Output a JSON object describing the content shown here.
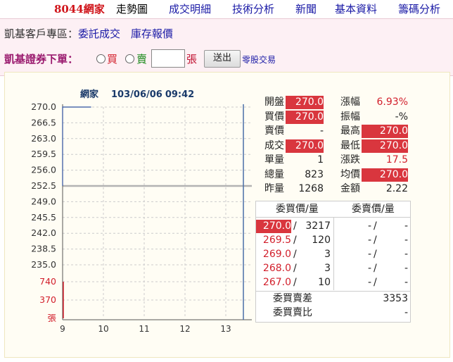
{
  "nav": {
    "stock": "8044網家",
    "items": [
      "走勢圖",
      "成交明細",
      "技術分析",
      "新聞",
      "基本資料",
      "籌碼分析"
    ]
  },
  "customer": {
    "label": "凱基客戶專區：",
    "links": [
      "委託成交",
      "庫存報價"
    ]
  },
  "order": {
    "title": "凱基證券下單：",
    "buy": "買",
    "sell": "賣",
    "unit": "張",
    "send": "送出",
    "odd_lot": "零股交易"
  },
  "chart_data": {
    "type": "line",
    "title": "網家",
    "date": "103/06/06",
    "time": "09:42",
    "price_ticks": [
      "270.0",
      "266.5",
      "263.0",
      "259.5",
      "256.0",
      "252.5",
      "249.0",
      "245.5",
      "242.0",
      "238.5",
      "235.0"
    ],
    "ylim": [
      235.0,
      270.0
    ],
    "reference_price": 252.5,
    "volume_ticks": [
      "740",
      "370",
      "張"
    ],
    "volume_max": 740,
    "x_ticks": [
      "9",
      "10",
      "11",
      "12",
      "13"
    ],
    "series": [
      {
        "x": [
          9.0,
          9.0,
          9.7
        ],
        "y": [
          252.5,
          270.0,
          270.0
        ]
      }
    ],
    "volume": {
      "x": [
        9.0
      ],
      "y": [
        740
      ]
    }
  },
  "quote": {
    "left": [
      {
        "label": "開盤",
        "value": "270.0",
        "hl": true
      },
      {
        "label": "買價",
        "value": "270.0",
        "hl": true
      },
      {
        "label": "賣價",
        "value": "-",
        "hl": false
      },
      {
        "label": "成交",
        "value": "270.0",
        "hl": true
      },
      {
        "label": "單量",
        "value": "1",
        "hl": false
      },
      {
        "label": "總量",
        "value": "823",
        "hl": false
      },
      {
        "label": "昨量",
        "value": "1268",
        "hl": false
      }
    ],
    "right": [
      {
        "label": "漲幅",
        "value": "6.93%",
        "hl": false,
        "red": true
      },
      {
        "label": "振幅",
        "value": "-%",
        "hl": false,
        "red": false
      },
      {
        "label": "最高",
        "value": "270.0",
        "hl": true
      },
      {
        "label": "最低",
        "value": "270.0",
        "hl": true
      },
      {
        "label": "漲跌",
        "value": "17.5",
        "hl": false,
        "red": true
      },
      {
        "label": "均價",
        "value": "270.0",
        "hl": true
      },
      {
        "label": "金額",
        "value": "2.22",
        "hl": false,
        "red": false
      }
    ]
  },
  "orderbook": {
    "bid_header": "委買價/量",
    "ask_header": "委賣價/量",
    "rows": [
      {
        "bid_price": "270.0",
        "bid_vol": "3217",
        "ask_price": "-",
        "ask_vol": "-"
      },
      {
        "bid_price": "269.5",
        "bid_vol": "120",
        "ask_price": "-",
        "ask_vol": "-"
      },
      {
        "bid_price": "269.0",
        "bid_vol": "3",
        "ask_price": "-",
        "ask_vol": "-"
      },
      {
        "bid_price": "268.0",
        "bid_vol": "3",
        "ask_price": "-",
        "ask_vol": "-"
      },
      {
        "bid_price": "267.0",
        "bid_vol": "10",
        "ask_price": "-",
        "ask_vol": "-"
      }
    ],
    "diff_label": "委買賣差",
    "diff_value": "3353",
    "ratio_label": "委買賣比",
    "ratio_value": "-"
  }
}
